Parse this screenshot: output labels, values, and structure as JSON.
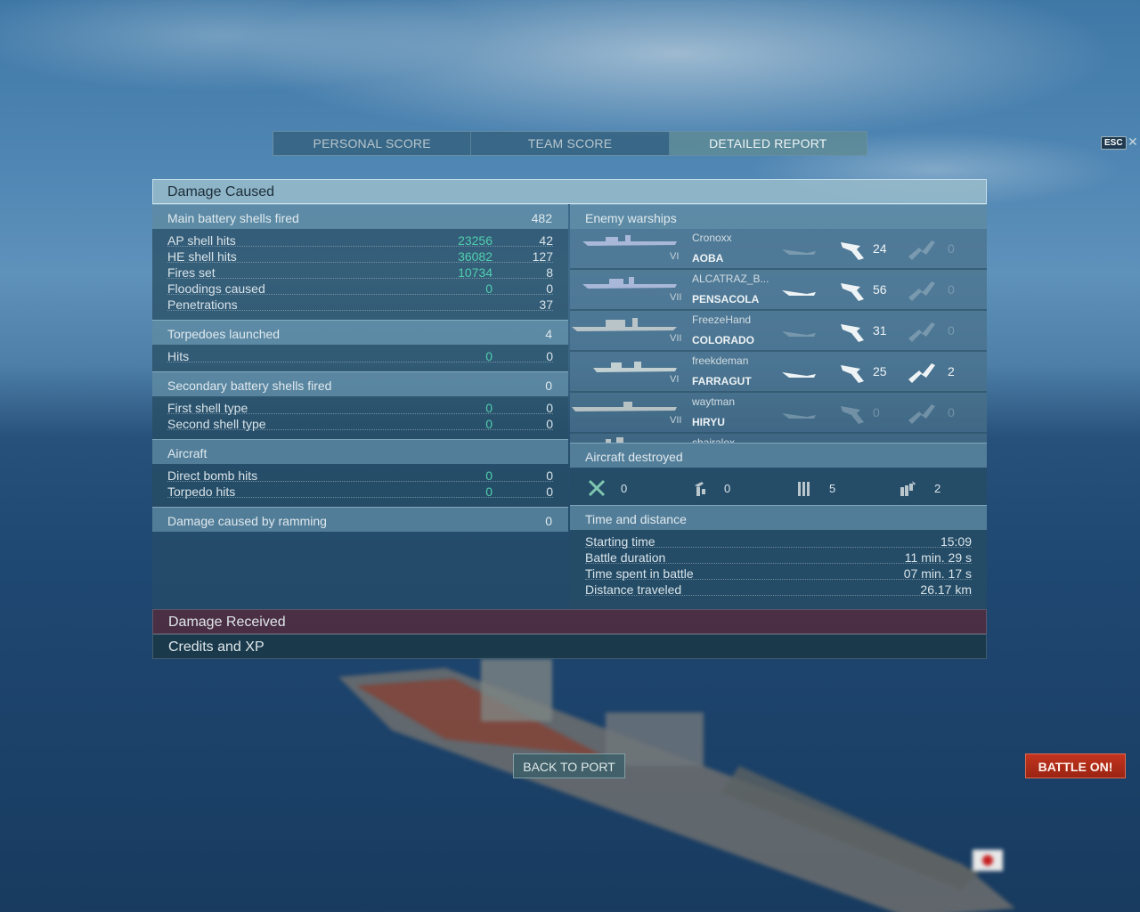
{
  "tabs": [
    "PERSONAL SCORE",
    "TEAM SCORE",
    "DETAILED REPORT"
  ],
  "esc_label": "ESC",
  "damage_caused": {
    "title": "Damage Caused",
    "main_battery": {
      "label": "Main battery shells fired",
      "value": "482",
      "rows": [
        {
          "label": "AP shell hits",
          "damage": "23256",
          "value": "42"
        },
        {
          "label": "HE shell hits",
          "damage": "36082",
          "value": "127"
        },
        {
          "label": "Fires set",
          "damage": "10734",
          "value": "8"
        },
        {
          "label": "Floodings caused",
          "damage": "0",
          "value": "0"
        },
        {
          "label": "Penetrations",
          "damage": "",
          "value": "37"
        }
      ]
    },
    "torpedoes": {
      "label": "Torpedoes launched",
      "value": "4",
      "rows": [
        {
          "label": "Hits",
          "damage": "0",
          "value": "0"
        }
      ]
    },
    "secondary": {
      "label": "Secondary battery shells fired",
      "value": "0",
      "rows": [
        {
          "label": "First shell type",
          "damage": "0",
          "value": "0"
        },
        {
          "label": "Second shell type",
          "damage": "0",
          "value": "0"
        }
      ]
    },
    "aircraft": {
      "label": "Aircraft",
      "rows": [
        {
          "label": "Direct bomb hits",
          "damage": "0",
          "value": "0"
        },
        {
          "label": "Torpedo hits",
          "damage": "0",
          "value": "0"
        }
      ]
    },
    "ramming": {
      "label": "Damage caused by ramming",
      "value": "0"
    }
  },
  "enemy_warships": {
    "label": "Enemy warships",
    "ships": [
      {
        "player": "Cronoxx",
        "ship": "AOBA",
        "tier": "VI",
        "hits": "24",
        "destroyed": "0"
      },
      {
        "player": "ALCATRAZ_B...",
        "ship": "PENSACOLA",
        "tier": "VII",
        "hits": "56",
        "destroyed": "0"
      },
      {
        "player": "FreezeHand",
        "ship": "COLORADO",
        "tier": "VII",
        "hits": "31",
        "destroyed": "0"
      },
      {
        "player": "freekdeman",
        "ship": "FARRAGUT",
        "tier": "VI",
        "hits": "25",
        "destroyed": "2"
      },
      {
        "player": "waytman",
        "ship": "HIRYU",
        "tier": "VII",
        "hits": "0",
        "destroyed": "0"
      },
      {
        "player": "chairalex",
        "ship": "",
        "tier": "",
        "hits": "",
        "destroyed": ""
      }
    ]
  },
  "aircraft_destroyed": {
    "label": "Aircraft destroyed",
    "items": [
      {
        "icon": "fighter-icon",
        "value": "0"
      },
      {
        "icon": "dive-bomber-icon",
        "value": "0"
      },
      {
        "icon": "torpedo-bomber-icon",
        "value": "5"
      },
      {
        "icon": "bomber-squadron-icon",
        "value": "2"
      }
    ]
  },
  "time_distance": {
    "label": "Time and distance",
    "rows": [
      {
        "label": "Starting time",
        "value": "15:09"
      },
      {
        "label": "Battle duration",
        "value": "11 min. 29 s"
      },
      {
        "label": "Time spent in battle",
        "value": "07 min. 17 s"
      },
      {
        "label": "Distance traveled",
        "value": "26.17 km"
      }
    ]
  },
  "damage_received": "Damage Received",
  "credits_xp": "Credits and XP",
  "buttons": {
    "back": "BACK TO PORT",
    "battle": "BATTLE ON!"
  }
}
